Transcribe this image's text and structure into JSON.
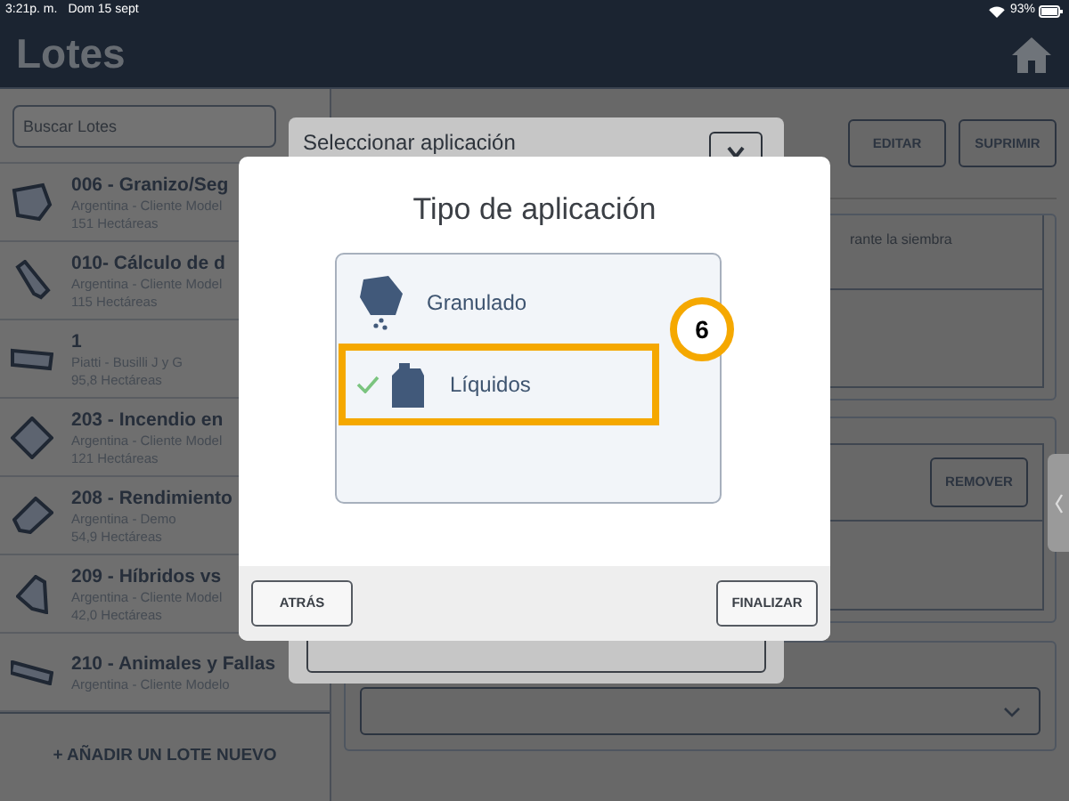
{
  "status_bar": {
    "time": "3:21p. m.",
    "date": "Dom 15 sept",
    "battery": "93%"
  },
  "header": {
    "title": "Lotes"
  },
  "sidebar": {
    "search": {
      "placeholder": "Buscar Lotes"
    },
    "items": [
      {
        "name": "006 - Granizo/Seg",
        "details": [
          "Argentina - Cliente Model",
          "151 Hectáreas"
        ]
      },
      {
        "name": "010- Cálculo de d",
        "details": [
          "Argentina - Cliente Model",
          "115 Hectáreas"
        ]
      },
      {
        "name": "1",
        "details": [
          "Piatti - Busilli J y G",
          "95,8 Hectáreas"
        ]
      },
      {
        "name": "203 - Incendio en",
        "details": [
          "Argentina - Cliente Model",
          "121 Hectáreas"
        ]
      },
      {
        "name": "208 - Rendimiento",
        "details": [
          "Argentina - Demo",
          "54,9 Hectáreas"
        ]
      },
      {
        "name": "209 - Híbridos vs",
        "details": [
          "Argentina - Cliente Model",
          "42,0 Hectáreas"
        ]
      },
      {
        "name": "210 - Animales y Fallas",
        "details": [
          "Argentina - Cliente Modelo"
        ]
      }
    ],
    "add_button": "+ AÑADIR UN LOTE NUEVO"
  },
  "detail": {
    "buttons": [
      "EDITAR",
      "SUPRIMIR"
    ],
    "note": "rante la siembra",
    "remove_button": "REMOVER"
  },
  "background_dialog": {
    "title": "Seleccionar aplicación"
  },
  "modal": {
    "title": "Tipo de aplicación",
    "options": [
      {
        "label": "Granulado",
        "kind": "granular",
        "selected": false,
        "highlighted": false
      },
      {
        "label": "Líquidos",
        "kind": "liquid",
        "selected": true,
        "highlighted": true
      }
    ],
    "callout": "6",
    "buttons": [
      "ATRÁS",
      "FINALIZAR"
    ]
  }
}
